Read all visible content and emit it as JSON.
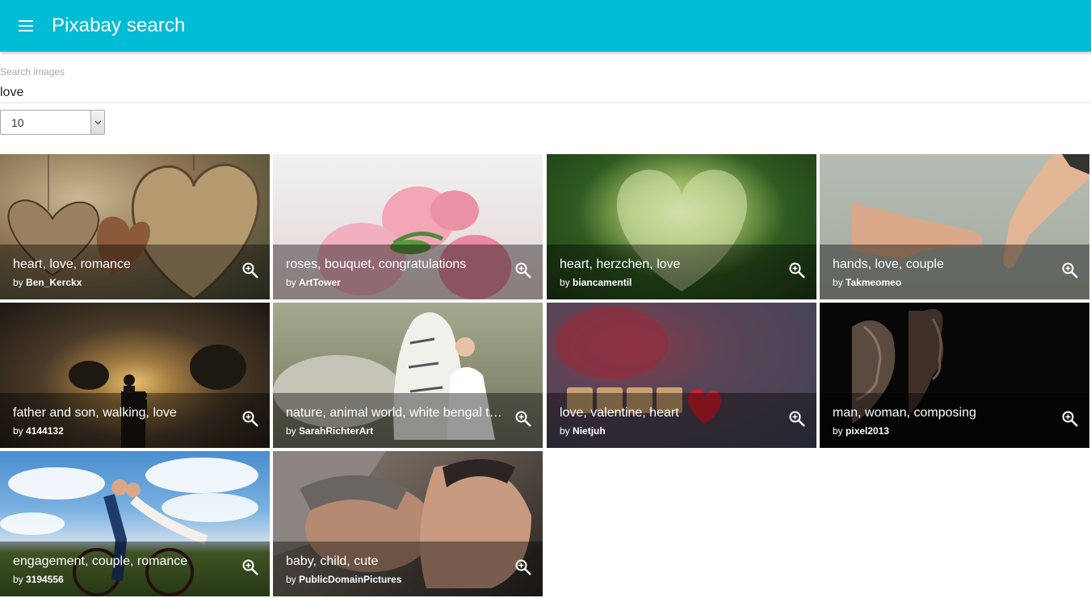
{
  "appbar": {
    "title": "Pixabay search",
    "menu_icon": "hamburger-menu-icon",
    "color": "#00bcd4"
  },
  "search": {
    "label": "Search images",
    "value": "love"
  },
  "amount_select": {
    "value": "10"
  },
  "images": [
    {
      "tags": "heart, love, romance",
      "by": "by",
      "user": "Ben_Kerckx"
    },
    {
      "tags": "roses, bouquet, congratulations",
      "by": "by",
      "user": "ArtTower"
    },
    {
      "tags": "heart, herzchen, love",
      "by": "by",
      "user": "biancamentil"
    },
    {
      "tags": "hands, love, couple",
      "by": "by",
      "user": "Takmeomeo"
    },
    {
      "tags": "father and son, walking, love",
      "by": "by",
      "user": "4144132"
    },
    {
      "tags": "nature, animal world, white bengal tiger",
      "by": "by",
      "user": "SarahRichterArt"
    },
    {
      "tags": "love, valentine, heart",
      "by": "by",
      "user": "Nietjuh"
    },
    {
      "tags": "man, woman, composing",
      "by": "by",
      "user": "pixel2013"
    },
    {
      "tags": "engagement, couple, romance",
      "by": "by",
      "user": "3194556"
    },
    {
      "tags": "baby, child, cute",
      "by": "by",
      "user": "PublicDomainPictures"
    }
  ],
  "icons": {
    "zoom": "zoom-in-icon"
  }
}
